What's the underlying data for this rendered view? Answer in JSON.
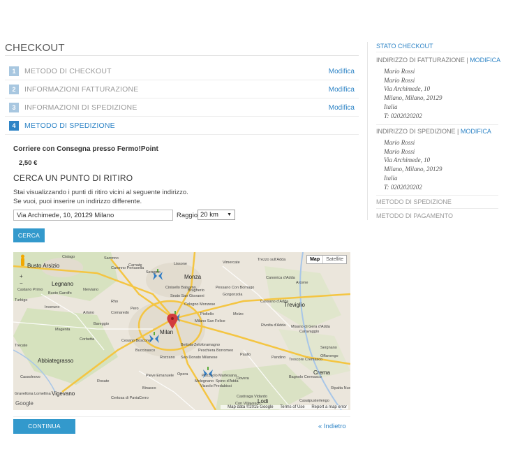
{
  "checkout": {
    "title": "CHECKOUT",
    "steps": [
      {
        "num": "1",
        "label": "METODO DI CHECKOUT",
        "edit": "Modifica"
      },
      {
        "num": "2",
        "label": "INFORMAZIONI FATTURAZIONE",
        "edit": "Modifica"
      },
      {
        "num": "3",
        "label": "INFORMAZIONI DI SPEDIZIONE",
        "edit": "Modifica"
      },
      {
        "num": "4",
        "label": "METODO DI SPEDIZIONE",
        "edit": ""
      }
    ]
  },
  "shipping": {
    "carrier": "Corriere con Consegna presso Fermo!Point",
    "price": "2,50 €",
    "pickup_title": "CERCA UN PUNTO DI RITIRO",
    "info_line1": "Stai visualizzando i punti di ritiro vicini al seguente indirizzo.",
    "info_line2": "Se vuoi, puoi inserire un indirizzo differente.",
    "address_value": "Via Archimede, 10, 20129 Milano",
    "radius_label": "Raggio",
    "radius_value": "20 km",
    "search_button": "CERCA",
    "continue_button": "CONTINUA",
    "back_link": "« Indietro"
  },
  "map": {
    "toggle_map": "Map",
    "toggle_satellite": "Satellite",
    "zoom_in": "+",
    "zoom_out": "−",
    "google_logo": "Google",
    "footer": [
      "Map data ©2015 Google",
      "Terms of Use",
      "Report a map error"
    ],
    "places": [
      "Busto Arsizio",
      "Saronno",
      "Cislago",
      "Carnate",
      "Lissone",
      "Vimercate",
      "Trezzo sull'Adda",
      "Caronno Pertusella",
      "Seregno",
      "Monza",
      "Cinisello Balsamo",
      "Canonica d'Adda",
      "Castano Primo",
      "Busto Garolfo",
      "Nerviano",
      "Legnano",
      "Rho",
      "Pero",
      "Sesto San Giovanni",
      "Brugherio",
      "Pessano Con Bornago",
      "Gorgonzola",
      "Cassano d'Adda",
      "Arcene",
      "Turbigo",
      "Inveruno",
      "Arluno",
      "Cornaredo",
      "Cologno Monzese",
      "Pioltello",
      "Melzo",
      "Treviglio",
      "Magenta",
      "Bareggio",
      "Milan",
      "Milano San Felice",
      "Caravaggio",
      "Trecate",
      "Cesano Boscone",
      "Buccinasco",
      "Rozzano",
      "San Donato Milanese",
      "Peschiera Borromeo",
      "Rivolta d'Adda",
      "Misano di Gera d'Adda",
      "Corbetta",
      "Abbiategrasso",
      "Bettola-Zeloforamagno",
      "Paullo",
      "Pandino",
      "Crema",
      "Vigevano",
      "Cassolnovo",
      "Rosate",
      "Binasco",
      "Pieve Emanuele",
      "Opera",
      "Melegnano",
      "Lodi",
      "Casalpusterlengo",
      "Gravellona Lomellina",
      "Sergnano",
      "Offanengo",
      "Trescore Cremasco",
      "Dovera",
      "Bagnolo Cremasco",
      "Spino d'Adda",
      "Vizzolo Predabissi",
      "Certosa di Pavia",
      "Castiraga Vidardo",
      "Con Villavesco",
      "Ripalta Nuova",
      "Cerro",
      "Pozzuolo Martesana"
    ]
  },
  "sidebar": {
    "title": "STATO CHECKOUT",
    "billing_head": "INDIRIZZO DI FATTURAZIONE",
    "billing_edit": "MODIFICA",
    "billing": [
      "Mario Rossi",
      "Mario Rossi",
      "Via Archimede, 10",
      "Milano, Milano, 20129",
      "Italia",
      "T: 0202020202"
    ],
    "shipping_head": "INDIRIZZO DI SPEDIZIONE",
    "shipping_edit": "MODIFICA",
    "shipping": [
      "Mario Rossi",
      "Mario Rossi",
      "Via Archimede, 10",
      "Milano, Milano, 20129",
      "Italia",
      "T: 0202020202"
    ],
    "shipping_method": "METODO DI SPEDIZIONE",
    "payment_method": "METODO DI PAGAMENTO"
  }
}
